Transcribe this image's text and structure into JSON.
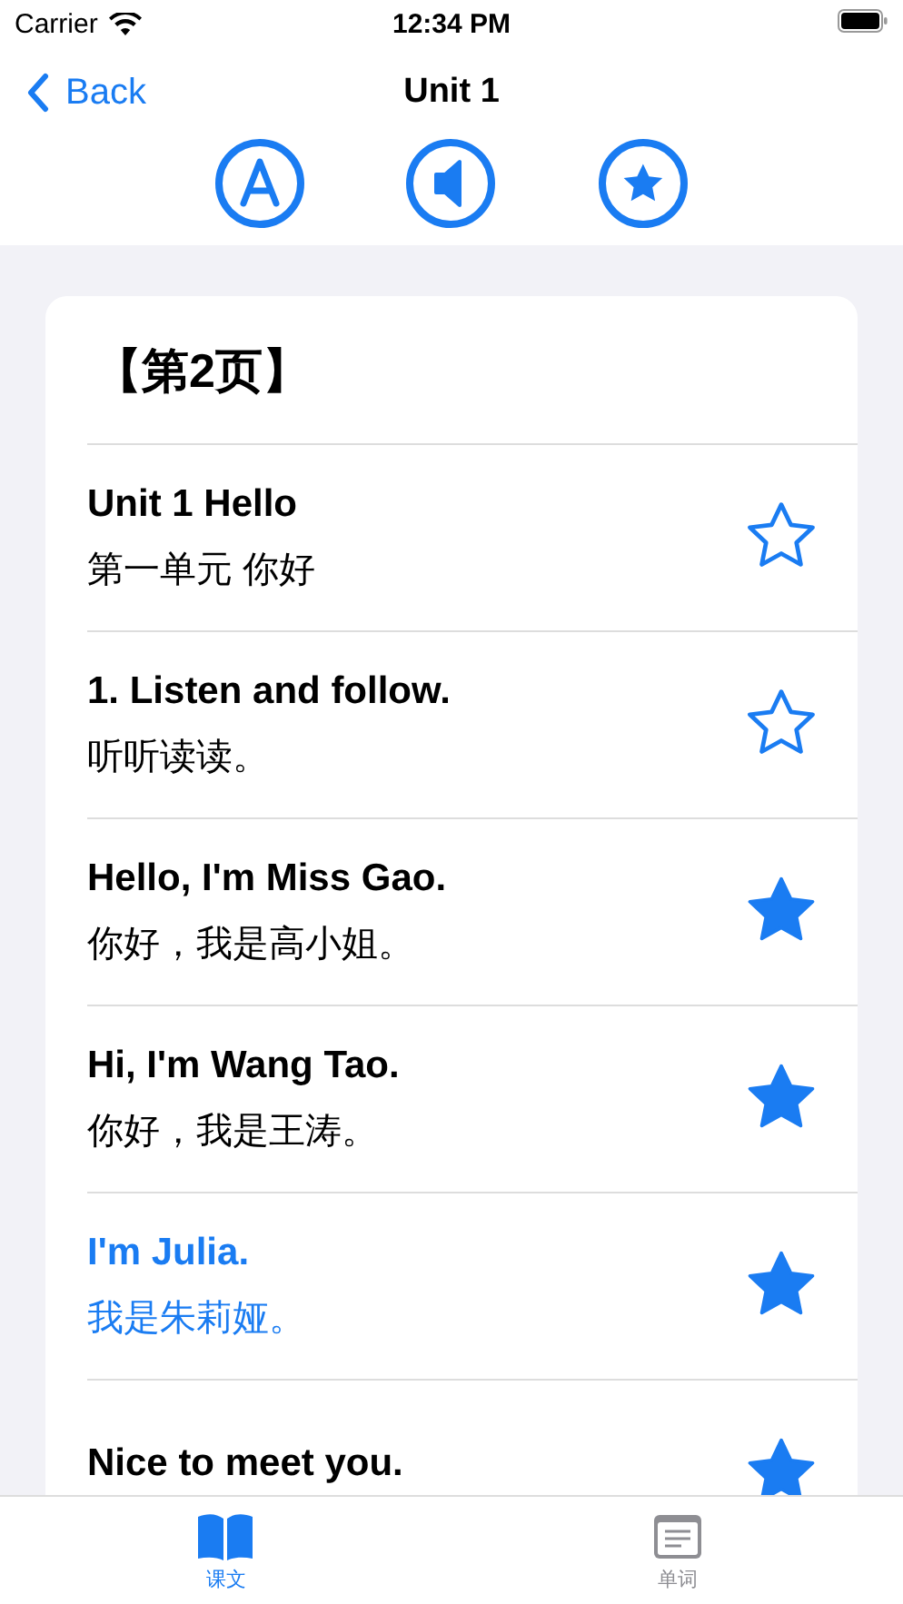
{
  "status_bar": {
    "carrier": "Carrier",
    "time": "12:34 PM"
  },
  "nav": {
    "back": "Back",
    "title": "Unit 1"
  },
  "page_title": "【第2页】",
  "sentences": [
    {
      "english": "Unit 1 Hello",
      "chinese": "第一单元 你好",
      "starred": false,
      "selected": false
    },
    {
      "english": "1. Listen and follow.",
      "chinese": "听听读读。",
      "starred": false,
      "selected": false
    },
    {
      "english": "Hello, I'm Miss Gao.",
      "chinese": "你好，我是高小姐。",
      "starred": true,
      "selected": false
    },
    {
      "english": "Hi, I'm Wang Tao.",
      "chinese": "你好，我是王涛。",
      "starred": true,
      "selected": false
    },
    {
      "english": "I'm Julia.",
      "chinese": "我是朱莉娅。",
      "starred": true,
      "selected": true
    },
    {
      "english": "Nice to meet you.",
      "starred": true,
      "selected": false
    }
  ],
  "tabs": [
    {
      "label": "课文",
      "selected": true,
      "kind": "book"
    },
    {
      "label": "单词",
      "selected": false,
      "kind": "list"
    }
  ]
}
